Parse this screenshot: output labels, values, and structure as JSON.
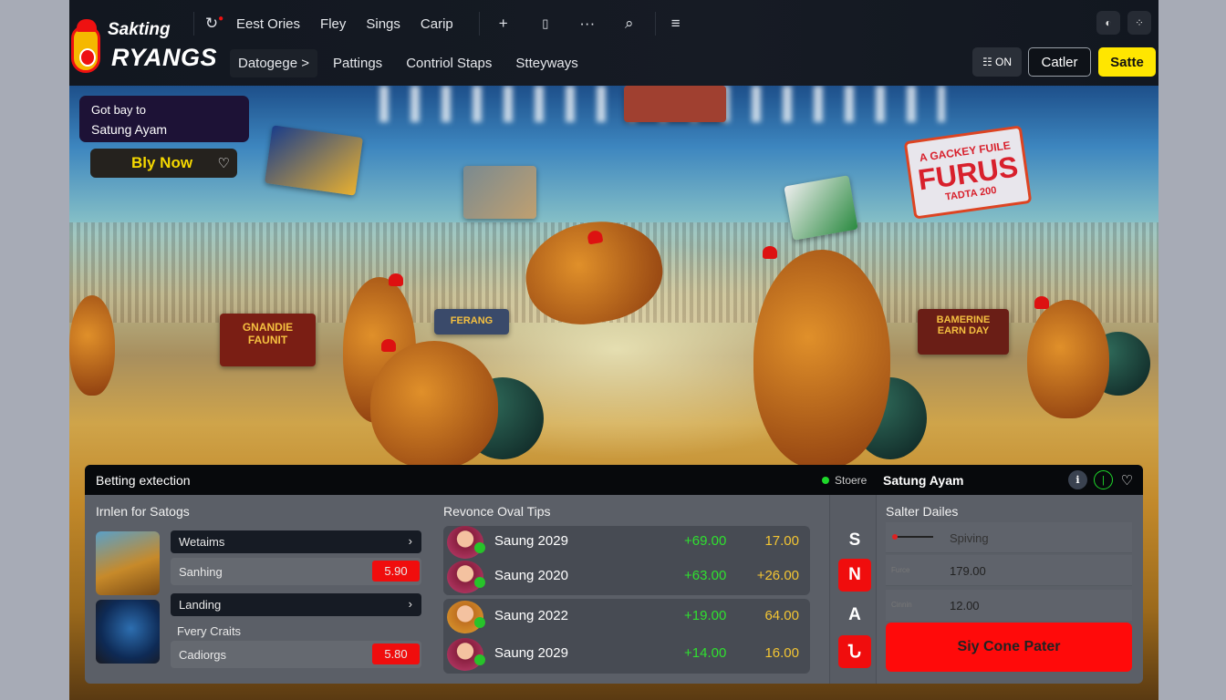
{
  "brand": {
    "line1": "Sakting",
    "line2": "RYANGS"
  },
  "topnav": {
    "items": [
      "Eest Ories",
      "Fley",
      "Sings",
      "Carip"
    ]
  },
  "subnav": {
    "items": [
      "Datogege >",
      "Pattings",
      "Contriol Staps",
      "Stteyways"
    ]
  },
  "header_buttons": {
    "toggle": "☷ ON",
    "caller": "Catler",
    "save": "Satte"
  },
  "hero": {
    "promo_line1": "Got bay to",
    "promo_line2": "Satung Ayam",
    "buy_now": "Bly Now",
    "ads": {
      "furus_top": "A GACKEY FUILE",
      "furus_main": "FURUS",
      "furus_bottom": "TADTA 200",
      "left_banner": "GNANDIE FAUNIT",
      "mid_banner": "FERANG",
      "right_banner": "BAMERINE EARN DAY"
    }
  },
  "panel": {
    "title": "Betting extection",
    "status": "Stoere",
    "event_name": "Satung Ayam",
    "left": {
      "heading": "Irnlen for Satogs",
      "rows": [
        {
          "title": "Wetaims",
          "label": "Sanhing",
          "price": "5.90"
        },
        {
          "title": "Landing",
          "sub": "Fvery Craits",
          "label": "Cadiorgs",
          "price": "5.80"
        }
      ]
    },
    "tips": {
      "heading": "Revonce Oval Tips",
      "rows": [
        {
          "name": "Saung 2029",
          "change": "+69.00",
          "odds": "17.00"
        },
        {
          "name": "Saung 2020",
          "change": "+63.00",
          "odds": "+26.00"
        },
        {
          "name": "Saung 2022",
          "change": "+19.00",
          "odds": "64.00"
        },
        {
          "name": "Saung 2029",
          "change": "+14.00",
          "odds": "16.00"
        }
      ]
    },
    "letters": [
      "S",
      "N",
      "A",
      "Ն"
    ],
    "right": {
      "heading": "Salter Dailes",
      "rows": [
        {
          "label": "",
          "value": "Spiving"
        },
        {
          "label": "Furce",
          "value": "179.00"
        },
        {
          "label": "Cinnin",
          "value": "12.00"
        }
      ],
      "cta": "Siy Cone Pater"
    }
  },
  "colors": {
    "accent_yellow": "#f5e000",
    "accent_red": "#f00d0d",
    "header_bg": "#12161d",
    "panel_bg": "#5b5f67",
    "positive": "#2fe02f",
    "odds": "#f3c533"
  }
}
